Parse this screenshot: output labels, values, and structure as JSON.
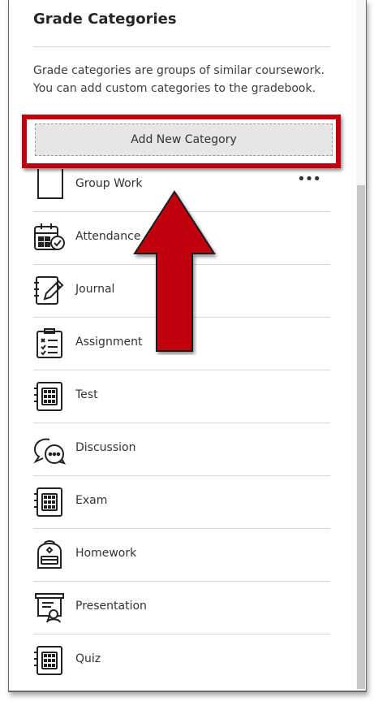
{
  "panel": {
    "title": "Grade Categories",
    "description": "Grade categories are groups of similar coursework. You can add custom categories to the gradebook.",
    "add_button_label": "Add New Category"
  },
  "categories": [
    {
      "label": "Group Work",
      "icon": "document-icon",
      "more": "•••"
    },
    {
      "label": "Attendance",
      "icon": "calendar-check-icon"
    },
    {
      "label": "Journal",
      "icon": "journal-pen-icon"
    },
    {
      "label": "Assignment",
      "icon": "checklist-icon"
    },
    {
      "label": "Test",
      "icon": "calculator-icon"
    },
    {
      "label": "Discussion",
      "icon": "chat-bubbles-icon"
    },
    {
      "label": "Exam",
      "icon": "calculator-icon"
    },
    {
      "label": "Homework",
      "icon": "backpack-icon"
    },
    {
      "label": "Presentation",
      "icon": "presentation-board-icon"
    },
    {
      "label": "Quiz",
      "icon": "calculator-icon"
    }
  ],
  "annotation": {
    "highlight_color": "#c0000f",
    "arrow_color": "#c0000f",
    "arrow_icon": "up-arrow-icon"
  }
}
